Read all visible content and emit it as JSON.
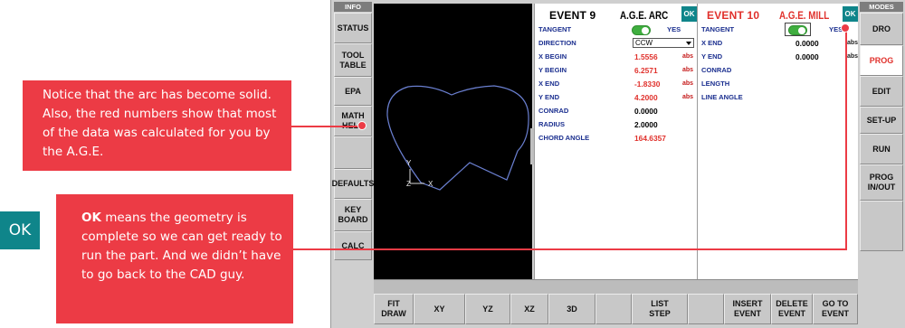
{
  "callouts": {
    "arc_note": "Notice that the arc has become solid.  Also, the red numbers show that most of the data was calculated for you by the A.G.E.",
    "ok_bold": "OK",
    "ok_note": " means the geometry is complete so we can get ready to run the part. And we didn’t have to go back to the CAD guy.",
    "ok_badge": "OK"
  },
  "headers": {
    "info": "INFO",
    "modes": "MODES"
  },
  "left_panel": [
    {
      "label": "STATUS"
    },
    {
      "label": "TOOL\nTABLE"
    },
    {
      "label": "EPA"
    },
    {
      "label": "MATH\nHELP"
    },
    {
      "label": ""
    },
    {
      "label": "DEFAULTS"
    },
    {
      "label": "KEY\nBOARD"
    },
    {
      "label": "CALC"
    }
  ],
  "right_panel": [
    {
      "label": "DRO",
      "active": false
    },
    {
      "label": "PROG",
      "active": true
    },
    {
      "label": "EDIT",
      "active": false
    },
    {
      "label": "SET-UP",
      "active": false
    },
    {
      "label": "RUN",
      "active": false
    },
    {
      "label": "PROG\nIN/OUT",
      "active": false
    },
    {
      "label": "",
      "active": false
    }
  ],
  "bottom_bar": [
    {
      "label": "FIT\nDRAW"
    },
    {
      "label": "XY"
    },
    {
      "label": "YZ"
    },
    {
      "label": "XZ"
    },
    {
      "label": "3D"
    },
    {
      "label": ""
    },
    {
      "label": "LIST\nSTEP"
    },
    {
      "label": ""
    },
    {
      "label": "INSERT\nEVENT"
    },
    {
      "label": "DELETE\nEVENT"
    },
    {
      "label": "GO TO\nEVENT"
    }
  ],
  "viewport": {
    "axis_y": "Y",
    "axis_z": "Z",
    "axis_x": "X"
  },
  "event9": {
    "title": "EVENT 9",
    "type": "A.G.E. ARC",
    "ok": "OK",
    "tangent": {
      "label": "TANGENT",
      "value": "YES"
    },
    "direction": {
      "label": "DIRECTION",
      "value": "CCW"
    },
    "rows": [
      {
        "label": "X BEGIN",
        "value": "1.5556",
        "unit": "abs",
        "calc": true
      },
      {
        "label": "Y BEGIN",
        "value": "6.2571",
        "unit": "abs",
        "calc": true
      },
      {
        "label": "X END",
        "value": "-1.8330",
        "unit": "abs",
        "calc": true
      },
      {
        "label": "Y END",
        "value": "4.2000",
        "unit": "abs",
        "calc": true
      },
      {
        "label": "CONRAD",
        "value": "0.0000",
        "unit": "",
        "calc": false
      },
      {
        "label": "RADIUS",
        "value": "2.0000",
        "unit": "",
        "calc": false
      },
      {
        "label": "CHORD ANGLE",
        "value": "164.6357",
        "unit": "",
        "calc": true
      }
    ]
  },
  "event10": {
    "title": "EVENT 10",
    "type": "A.G.E. MILL",
    "ok": "OK",
    "tangent": {
      "label": "TANGENT",
      "value": "YES"
    },
    "rows": [
      {
        "label": "X END",
        "value": "0.0000",
        "unit": "abs"
      },
      {
        "label": "Y END",
        "value": "0.0000",
        "unit": "abs"
      },
      {
        "label": "CONRAD",
        "value": "",
        "unit": ""
      },
      {
        "label": "LENGTH",
        "value": "",
        "unit": ""
      },
      {
        "label": "LINE ANGLE",
        "value": "",
        "unit": ""
      }
    ]
  },
  "colors": {
    "callout": "#ec3b45",
    "ok": "#0f858a",
    "calculated": "#e0312c",
    "label": "#1b2f8f",
    "active_mode": "#e0312c"
  }
}
